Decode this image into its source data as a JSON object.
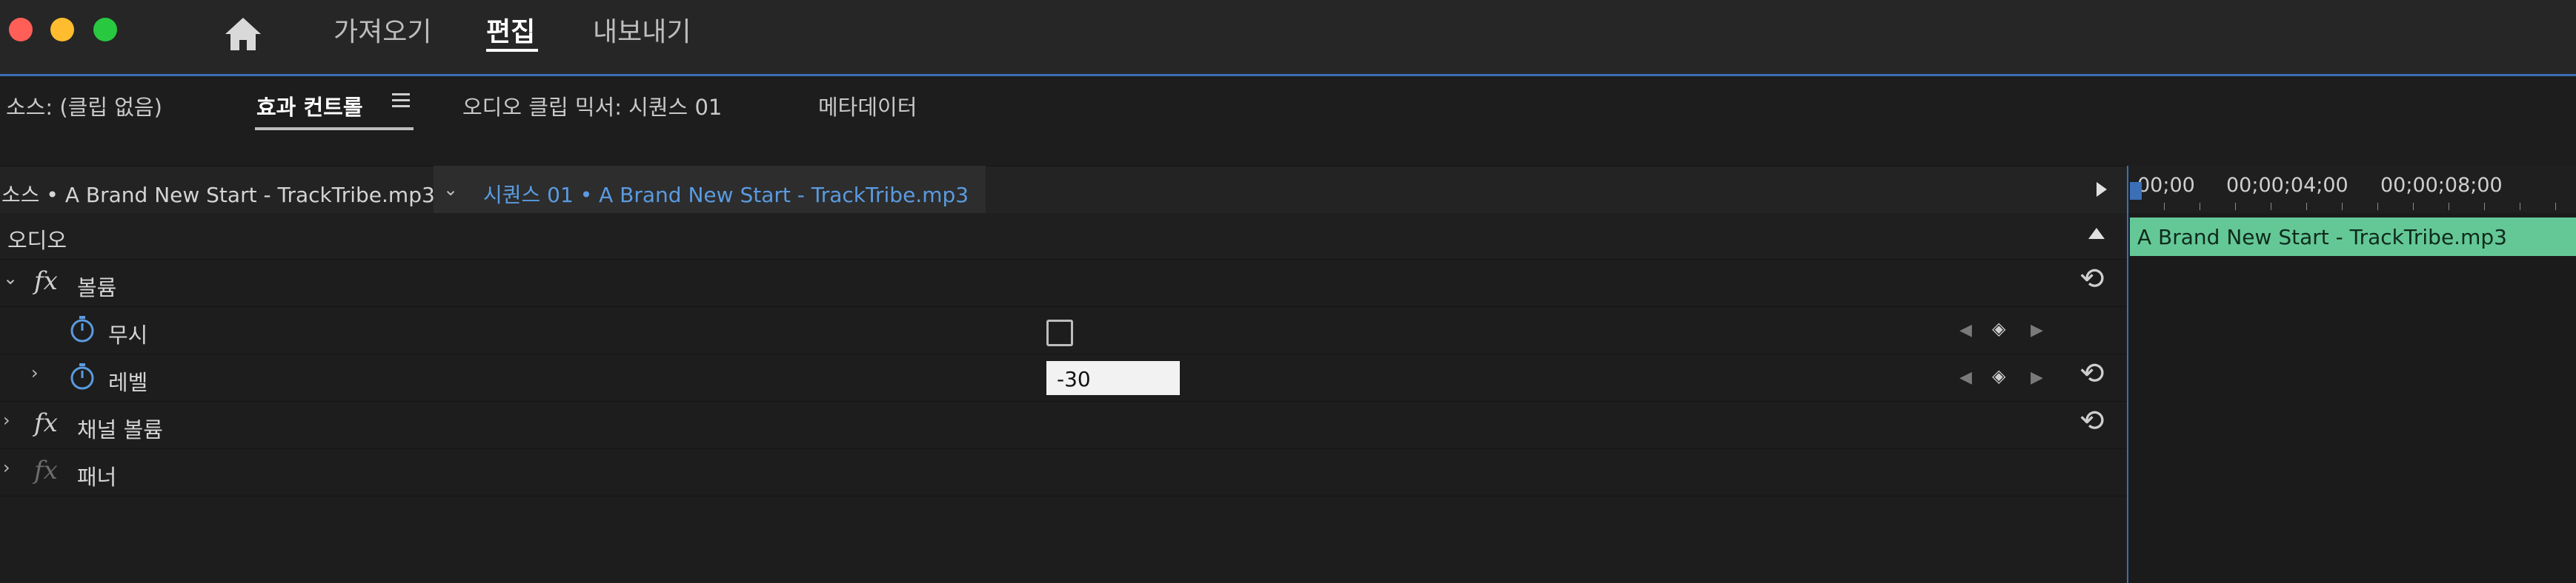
{
  "window": {
    "close_color": "#ff5f57",
    "minimize_color": "#febc2e",
    "zoom_color": "#28c840"
  },
  "nav": {
    "home_icon": "home-icon",
    "items": [
      {
        "label": "가져오기"
      },
      {
        "label": "편집"
      },
      {
        "label": "내보내기"
      }
    ]
  },
  "panel_tabs": [
    {
      "label": "소스: (클립 없음)"
    },
    {
      "label": "효과 컨트롤"
    },
    {
      "label": "오디오 클립 믹서: 시퀀스 01"
    },
    {
      "label": "메타데이터"
    }
  ],
  "header": {
    "source_label": "소스 • A Brand New Start - TrackTribe.mp3",
    "sequence_label": "시퀀스 01 • A Brand New Start - TrackTribe.mp3"
  },
  "sections": {
    "audio": "오디오",
    "volume": "볼륨",
    "bypass": "무시",
    "level": "레벨",
    "level_value": "-30",
    "channel_volume": "채널 볼륨",
    "panner": "패너",
    "fx_label": "fx"
  },
  "timeline": {
    "timecodes": [
      "00;00",
      "00;00;04;00",
      "00;00;08;00"
    ],
    "clip_name": "A Brand New Start - TrackTribe.mp3",
    "clip_color": "#64c896",
    "accent": "#3b6fb6"
  }
}
